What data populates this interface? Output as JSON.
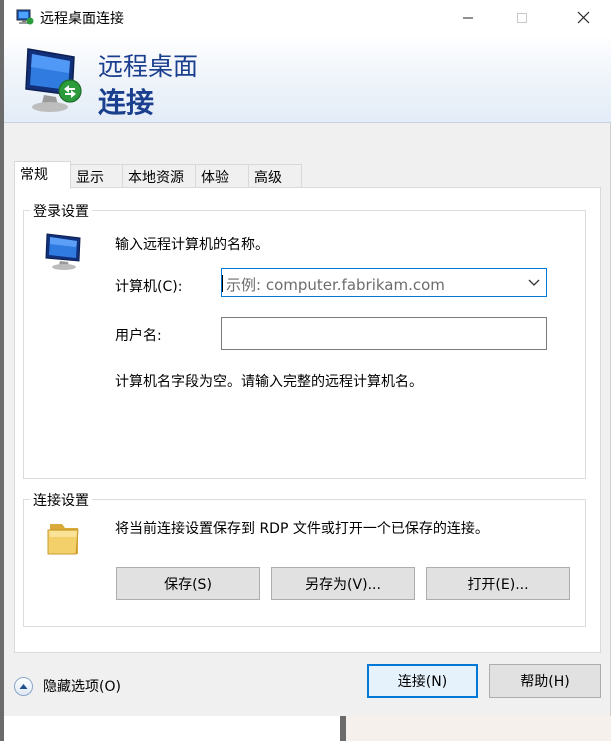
{
  "window": {
    "title": "远程桌面连接"
  },
  "banner": {
    "line1": "远程桌面",
    "line2": "连接"
  },
  "tabs": [
    {
      "label": "常规",
      "active": true
    },
    {
      "label": "显示",
      "active": false
    },
    {
      "label": "本地资源",
      "active": false
    },
    {
      "label": "体验",
      "active": false
    },
    {
      "label": "高级",
      "active": false
    }
  ],
  "login": {
    "group_title": "登录设置",
    "instruction": "输入远程计算机的名称。",
    "computer_label": "计算机(C):",
    "computer_placeholder": "示例: computer.fabrikam.com",
    "computer_value": "",
    "username_label": "用户名:",
    "username_value": "",
    "status_message": "计算机名字段为空。请输入完整的远程计算机名。"
  },
  "connection": {
    "group_title": "连接设置",
    "description": "将当前连接设置保存到 RDP 文件或打开一个已保存的连接。",
    "save_label": "保存(S)",
    "save_as_label": "另存为(V)...",
    "open_label": "打开(E)..."
  },
  "footer": {
    "hide_options_label": "隐藏选项(O)",
    "connect_label": "连接(N)",
    "help_label": "帮助(H)"
  },
  "colors": {
    "banner_text": "#1a3f8e",
    "focus_border": "#0078d7"
  }
}
